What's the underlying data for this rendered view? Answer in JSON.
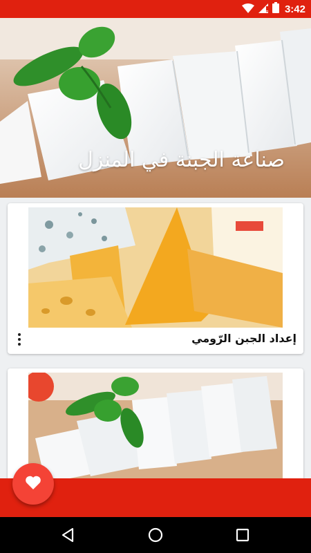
{
  "status_bar": {
    "time": "3:42",
    "icons": [
      "wifi-icon",
      "cell-signal-icon",
      "battery-icon"
    ],
    "background": "#e0210f"
  },
  "hero": {
    "title": "صناعة الجبنة في المنزل",
    "image": "white-cheese-with-basil-photo"
  },
  "cards": [
    {
      "title": "إعداد الجبن الرّومي",
      "image": "assorted-cheese-photo",
      "menu_icon": "more-vert-icon"
    },
    {
      "title": "",
      "image": "white-cheese-cubes-photo"
    }
  ],
  "fab": {
    "icon": "heart-icon",
    "color": "#f44336"
  },
  "bottom_bar": {
    "color": "#e0210f"
  },
  "nav_bar": {
    "icons": [
      "back-icon",
      "home-icon",
      "recents-icon"
    ]
  }
}
